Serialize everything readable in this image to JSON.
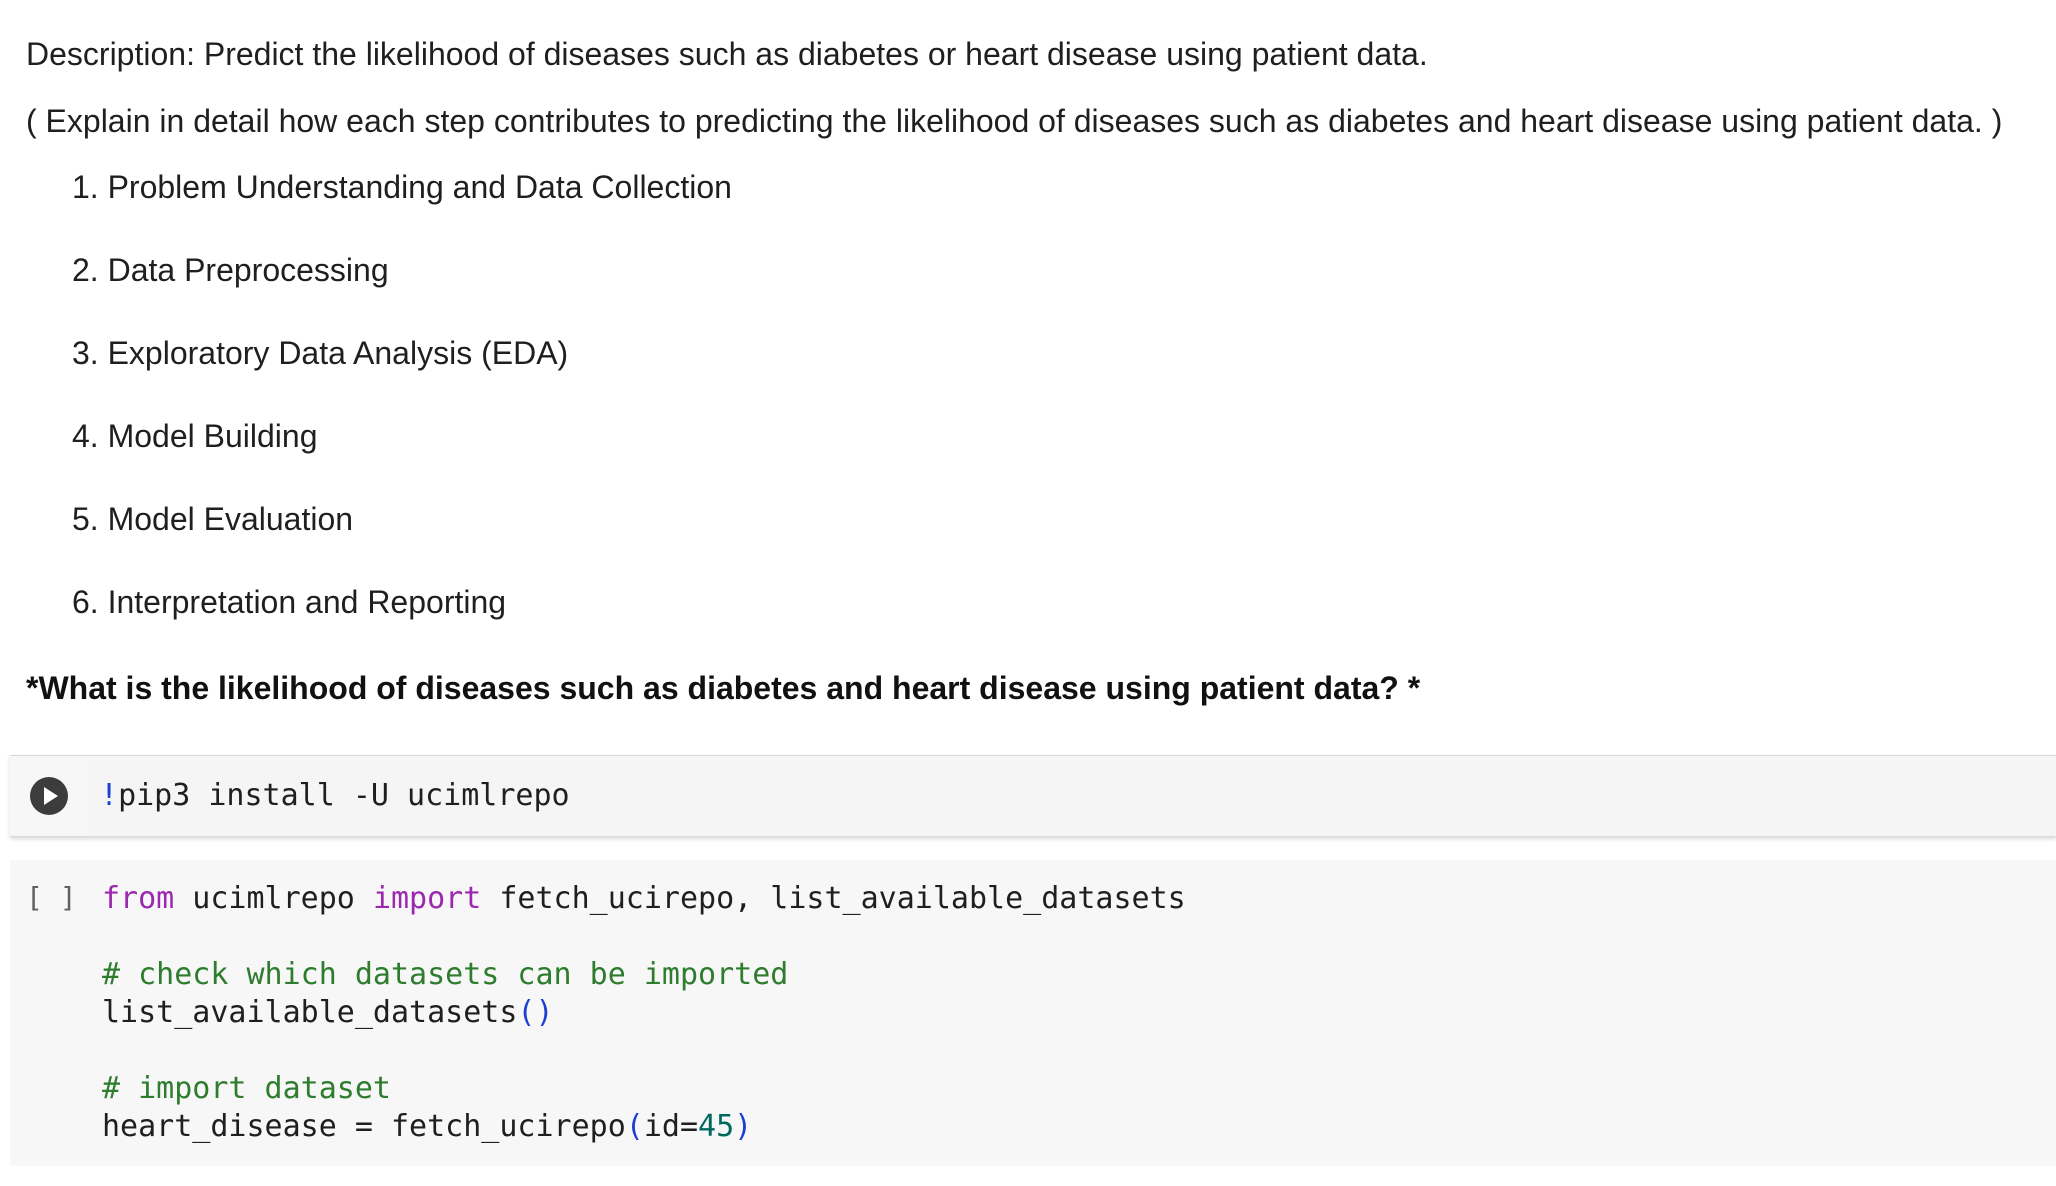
{
  "description": "Description: Predict the likelihood of diseases such as diabetes or heart disease using patient data.",
  "explanation": "( Explain in detail how each step contributes to predicting the likelihood of diseases such as diabetes and heart disease using patient data. )",
  "steps": [
    "1. Problem Understanding and Data Collection",
    "2. Data Preprocessing",
    "3. Exploratory Data Analysis (EDA)",
    "4. Model Building",
    "5. Model Evaluation",
    "6. Interpretation and Reporting"
  ],
  "question": "*What is the likelihood of diseases such as diabetes and heart disease using patient data? *",
  "cell1": {
    "run_icon": "play-icon",
    "bang": "!",
    "code": "pip3 install -U ucimlrepo"
  },
  "cell2": {
    "exec_count": "[ ]",
    "kw_from": "from",
    "module": " ucimlrepo ",
    "kw_import": "import",
    "imports": " fetch_ucirepo, list_available_datasets",
    "comment1": "# check which datasets can be imported",
    "call1_name": "list_available_datasets",
    "call1_parens": "()",
    "comment2": "# import dataset",
    "assign_lhs": "heart_disease = fetch_ucirepo",
    "paren_open": "(",
    "arg": "id=",
    "arg_value": "45",
    "paren_close": ")"
  },
  "colors": {
    "keyword": "#9c27b0",
    "comment": "#2e7d2e",
    "paren": "#1a3fd1",
    "number": "#00695c"
  }
}
